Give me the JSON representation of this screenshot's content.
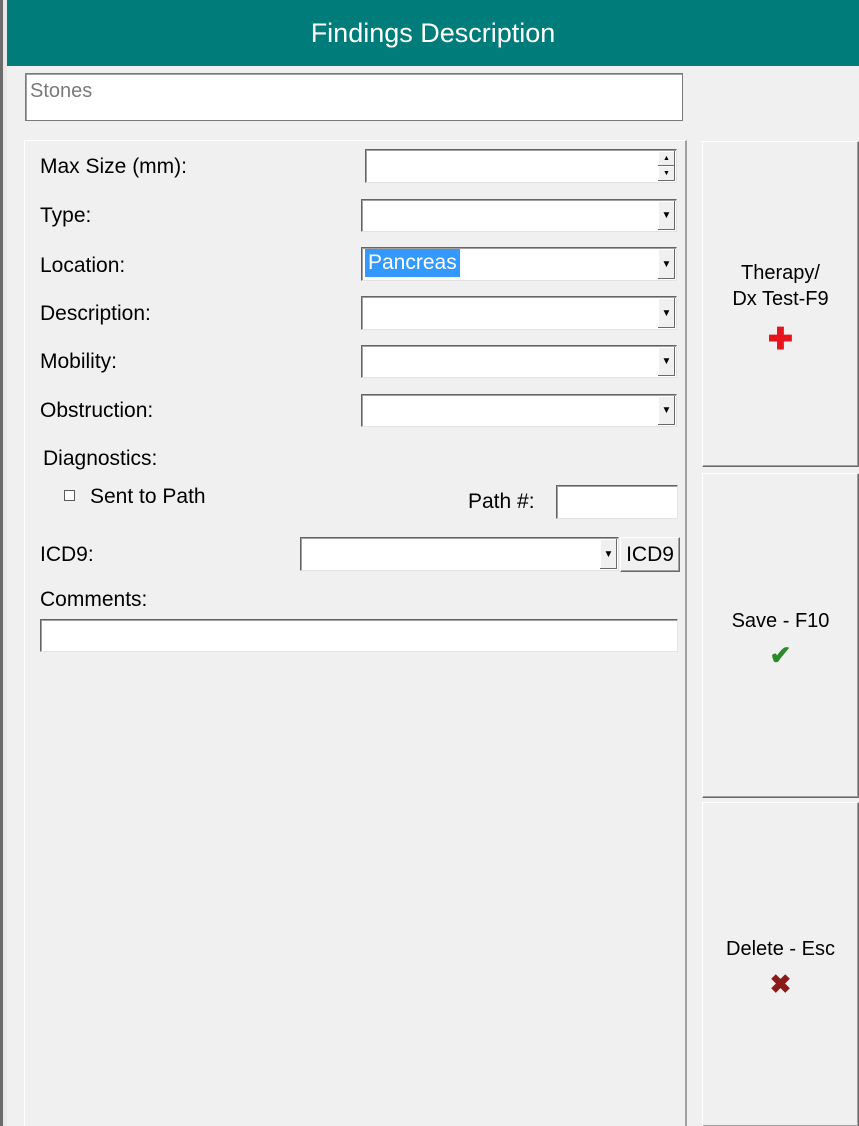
{
  "window": {
    "title": "Findings Description"
  },
  "finding": {
    "name": "Stones"
  },
  "form": {
    "max_size_label": "Max Size (mm):",
    "max_size_value": "",
    "type_label": "Type:",
    "type_value": "",
    "location_label": "Location:",
    "location_value": "Pancreas",
    "description_label": "Description:",
    "description_value": "",
    "mobility_label": "Mobility:",
    "mobility_value": "",
    "obstruction_label": "Obstruction:",
    "obstruction_value": "",
    "diagnostics_label": "Diagnostics:",
    "sent_to_path_label": "Sent to Path",
    "sent_to_path_checked": false,
    "path_number_label": "Path #:",
    "path_number_value": "",
    "icd9_label": "ICD9:",
    "icd9_value": "",
    "icd9_button_label": "ICD9",
    "comments_label": "Comments:",
    "comments_value": ""
  },
  "buttons": {
    "therapy_line1": "Therapy/",
    "therapy_line2": "Dx Test-F9",
    "therapy_icon": "red-cross-icon",
    "save_label": "Save - F10",
    "save_icon": "checkmark-icon",
    "delete_label": "Delete - Esc",
    "delete_icon": "x-icon"
  },
  "colors": {
    "title_bar": "#007d7b",
    "selection": "#3399ff",
    "therapy_icon": "#e8141c",
    "save_icon": "#2a8a2a",
    "delete_icon": "#8b1a1a"
  }
}
